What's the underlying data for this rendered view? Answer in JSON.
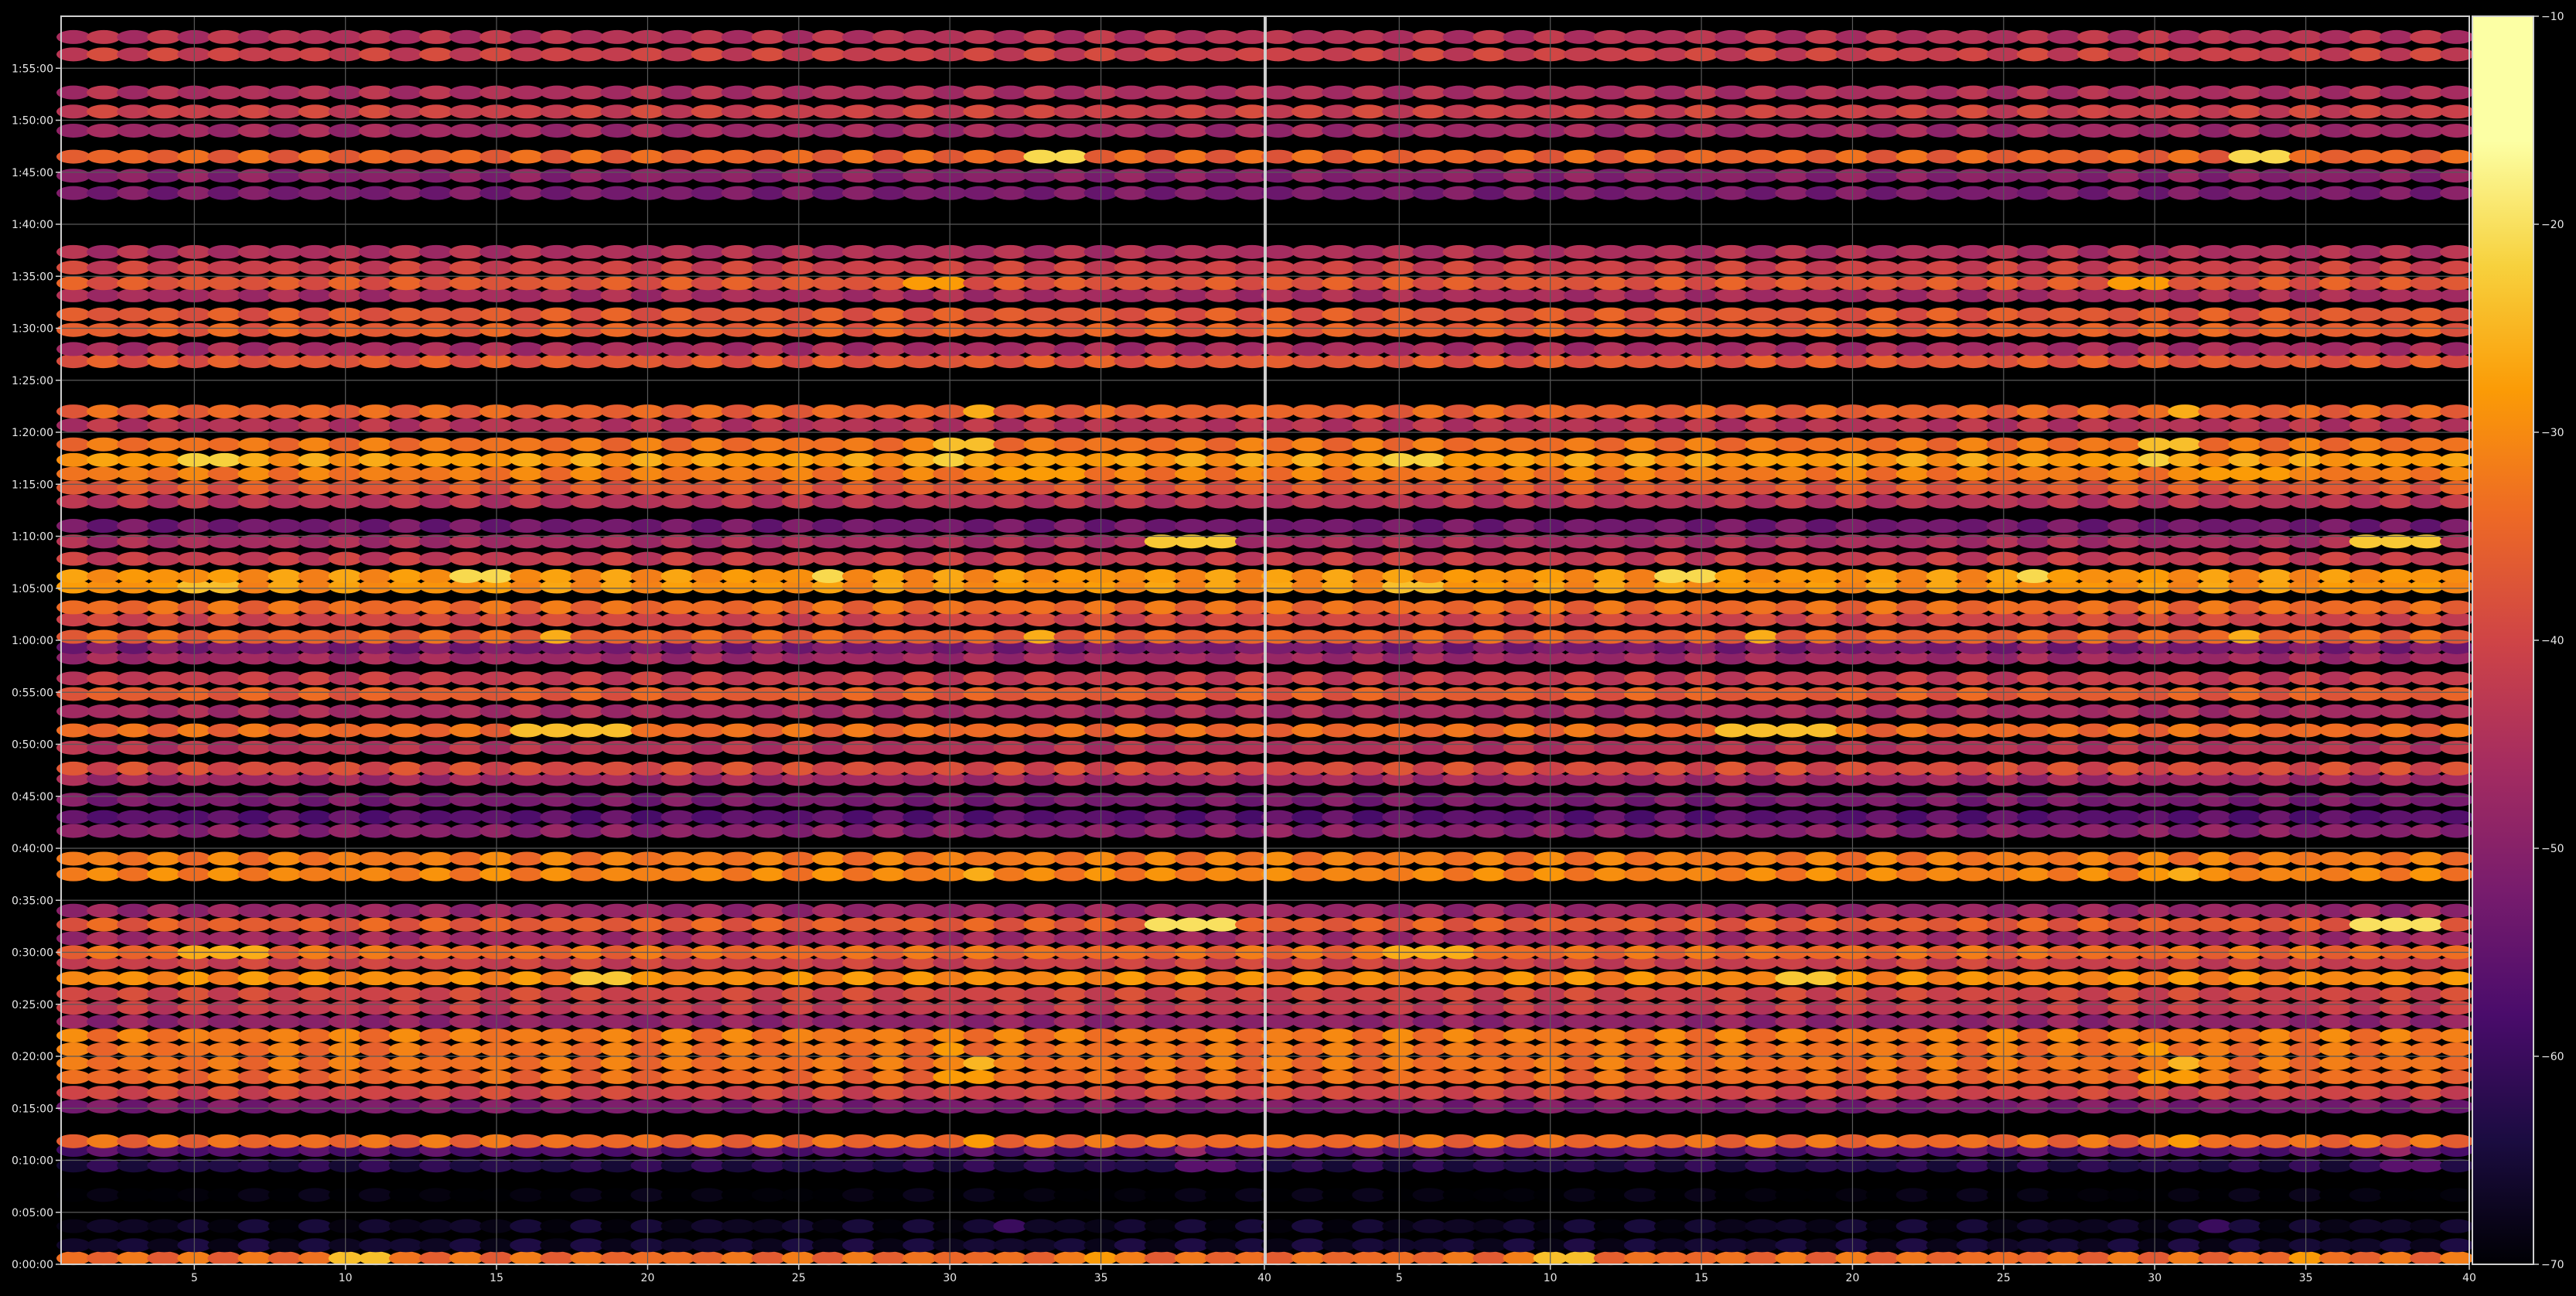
{
  "chart_data": {
    "type": "heatmap",
    "title": "",
    "xlabel": "",
    "ylabel": "",
    "colormap": "inferno",
    "grid": true,
    "background": "#000000",
    "gridline_color": "#5a5a5a",
    "panels": [
      {
        "xlim": [
          1,
          40
        ],
        "x_ticks": [
          5,
          10,
          15,
          20,
          25,
          30,
          35,
          40
        ],
        "x_tick_labels": [
          "5",
          "10",
          "15",
          "20",
          "25",
          "30",
          "35",
          "40"
        ]
      },
      {
        "xlim": [
          1,
          40
        ],
        "x_ticks": [
          5,
          10,
          15,
          20,
          25,
          30,
          35,
          40
        ],
        "x_tick_labels": [
          "5",
          "10",
          "15",
          "20",
          "25",
          "30",
          "35",
          "40"
        ]
      }
    ],
    "ylim_seconds": [
      0,
      7200
    ],
    "y_ticks_seconds": [
      0,
      300,
      600,
      900,
      1200,
      1500,
      1800,
      2100,
      2400,
      2700,
      3000,
      3300,
      3600,
      3900,
      4200,
      4500,
      4800,
      5100,
      5400,
      5700,
      6000,
      6300,
      6600,
      6900
    ],
    "y_tick_labels": [
      "0:00:00",
      "0:05:00",
      "0:10:00",
      "0:15:00",
      "0:20:00",
      "0:25:00",
      "0:30:00",
      "0:35:00",
      "0:40:00",
      "0:45:00",
      "0:50:00",
      "0:55:00",
      "1:00:00",
      "1:05:00",
      "1:10:00",
      "1:15:00",
      "1:20:00",
      "1:25:00",
      "1:30:00",
      "1:35:00",
      "1:40:00",
      "1:45:00",
      "1:50:00",
      "1:55:00"
    ],
    "colorbar": {
      "range": [
        -70,
        -10
      ],
      "ticks": [
        -10,
        -20,
        -30,
        -40,
        -50,
        -60,
        -70
      ],
      "tick_labels": [
        "−10",
        "−20",
        "−30",
        "−40",
        "−50",
        "−60",
        "−70"
      ]
    },
    "rows": [
      {
        "t": 35,
        "v": -34,
        "hot": [
          [
            10,
            -24
          ],
          [
            11,
            -24
          ],
          [
            35,
            -28
          ]
        ]
      },
      {
        "t": 110,
        "v": -66,
        "hot": []
      },
      {
        "t": 220,
        "v": -67,
        "hot": [
          [
            32,
            -60
          ]
        ]
      },
      {
        "t": 400,
        "v": -70,
        "hot": []
      },
      {
        "t": 570,
        "v": -63,
        "hot": [
          [
            38,
            -56
          ],
          [
            39,
            -56
          ]
        ]
      },
      {
        "t": 660,
        "v": -57,
        "hot": [
          [
            38,
            -48
          ]
        ]
      },
      {
        "t": 710,
        "v": -34,
        "hot": [
          [
            31,
            -28
          ]
        ]
      },
      {
        "t": 910,
        "v": -52,
        "hot": []
      },
      {
        "t": 990,
        "v": -40,
        "hot": []
      },
      {
        "t": 1080,
        "v": -34,
        "hot": [
          [
            30,
            -28
          ],
          [
            31,
            -28
          ]
        ]
      },
      {
        "t": 1160,
        "v": -33,
        "hot": [
          [
            31,
            -25
          ]
        ]
      },
      {
        "t": 1240,
        "v": -33,
        "hot": [
          [
            30,
            -28
          ]
        ]
      },
      {
        "t": 1320,
        "v": -32,
        "hot": []
      },
      {
        "t": 1400,
        "v": -49,
        "hot": []
      },
      {
        "t": 1480,
        "v": -42,
        "hot": []
      },
      {
        "t": 1560,
        "v": -40,
        "hot": []
      },
      {
        "t": 1650,
        "v": -30,
        "hot": [
          [
            18,
            -23
          ],
          [
            19,
            -23
          ]
        ]
      },
      {
        "t": 1740,
        "v": -41,
        "hot": []
      },
      {
        "t": 1800,
        "v": -34,
        "hot": [
          [
            5,
            -26
          ],
          [
            6,
            -26
          ],
          [
            7,
            -26
          ]
        ]
      },
      {
        "t": 1880,
        "v": -47,
        "hot": []
      },
      {
        "t": 1960,
        "v": -36,
        "hot": [
          [
            37,
            -20
          ],
          [
            38,
            -20
          ],
          [
            39,
            -20
          ]
        ]
      },
      {
        "t": 2040,
        "v": -48,
        "hot": []
      },
      {
        "t": 2250,
        "v": -31,
        "hot": [
          [
            31,
            -26
          ]
        ]
      },
      {
        "t": 2340,
        "v": -32,
        "hot": []
      },
      {
        "t": 2500,
        "v": -50,
        "hot": []
      },
      {
        "t": 2580,
        "v": -56,
        "hot": []
      },
      {
        "t": 2680,
        "v": -52,
        "hot": []
      },
      {
        "t": 2800,
        "v": -47,
        "hot": []
      },
      {
        "t": 2860,
        "v": -39,
        "hot": []
      },
      {
        "t": 2980,
        "v": -44,
        "hot": []
      },
      {
        "t": 3080,
        "v": -34,
        "hot": [
          [
            16,
            -24
          ],
          [
            17,
            -24
          ],
          [
            18,
            -24
          ],
          [
            19,
            -24
          ]
        ]
      },
      {
        "t": 3190,
        "v": -46,
        "hot": []
      },
      {
        "t": 3290,
        "v": -36,
        "hot": []
      },
      {
        "t": 3380,
        "v": -42,
        "hot": []
      },
      {
        "t": 3500,
        "v": -47,
        "hot": []
      },
      {
        "t": 3560,
        "v": -52,
        "hot": []
      },
      {
        "t": 3620,
        "v": -35,
        "hot": [
          [
            17,
            -26
          ],
          [
            33,
            -26
          ]
        ]
      },
      {
        "t": 3720,
        "v": -40,
        "hot": []
      },
      {
        "t": 3790,
        "v": -34,
        "hot": []
      },
      {
        "t": 3910,
        "v": -29,
        "hot": [
          [
            5,
            -24
          ],
          [
            6,
            -24
          ]
        ]
      },
      {
        "t": 3970,
        "v": -29,
        "hot": [
          [
            14,
            -21
          ],
          [
            15,
            -21
          ],
          [
            26,
            -21
          ]
        ]
      },
      {
        "t": 4070,
        "v": -42,
        "hot": []
      },
      {
        "t": 4170,
        "v": -46,
        "hot": [
          [
            37,
            -23
          ],
          [
            38,
            -23
          ],
          [
            39,
            -23
          ]
        ]
      },
      {
        "t": 4260,
        "v": -53,
        "hot": []
      },
      {
        "t": 4400,
        "v": -44,
        "hot": []
      },
      {
        "t": 4480,
        "v": -37,
        "hot": []
      },
      {
        "t": 4560,
        "v": -32,
        "hot": [
          [
            32,
            -28
          ],
          [
            33,
            -28
          ],
          [
            34,
            -28
          ]
        ]
      },
      {
        "t": 4640,
        "v": -28,
        "hot": [
          [
            5,
            -22
          ],
          [
            6,
            -22
          ],
          [
            30,
            -22
          ]
        ]
      },
      {
        "t": 4730,
        "v": -33,
        "hot": [
          [
            30,
            -24
          ],
          [
            31,
            -24
          ]
        ]
      },
      {
        "t": 4840,
        "v": -44,
        "hot": []
      },
      {
        "t": 4920,
        "v": -35,
        "hot": [
          [
            31,
            -26
          ]
        ]
      },
      {
        "t": 5210,
        "v": -37,
        "hot": []
      },
      {
        "t": 5280,
        "v": -46,
        "hot": []
      },
      {
        "t": 5390,
        "v": -36,
        "hot": []
      },
      {
        "t": 5480,
        "v": -37,
        "hot": []
      },
      {
        "t": 5590,
        "v": -46,
        "hot": []
      },
      {
        "t": 5660,
        "v": -37,
        "hot": [
          [
            29,
            -28
          ],
          [
            30,
            -28
          ]
        ]
      },
      {
        "t": 5750,
        "v": -41,
        "hot": []
      },
      {
        "t": 5840,
        "v": -45,
        "hot": []
      },
      {
        "t": 6180,
        "v": -52,
        "hot": []
      },
      {
        "t": 6280,
        "v": -50,
        "hot": []
      },
      {
        "t": 6390,
        "v": -35,
        "hot": [
          [
            33,
            -21
          ],
          [
            34,
            -21
          ]
        ]
      },
      {
        "t": 6540,
        "v": -47,
        "hot": []
      },
      {
        "t": 6650,
        "v": -41,
        "hot": []
      },
      {
        "t": 6760,
        "v": -45,
        "hot": []
      },
      {
        "t": 6980,
        "v": -41,
        "hot": []
      },
      {
        "t": 7080,
        "v": -44,
        "hot": []
      }
    ]
  }
}
